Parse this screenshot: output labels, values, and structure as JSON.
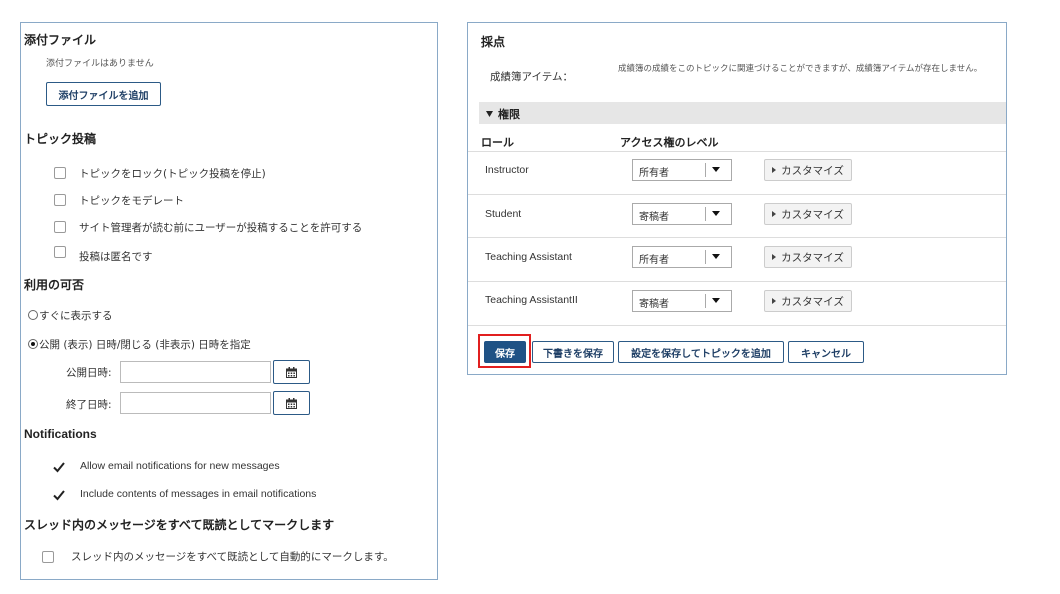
{
  "attachments": {
    "title": "添付ファイル",
    "empty": "添付ファイルはありません",
    "add_button": "添付ファイルを追加"
  },
  "topic_posting": {
    "title": "トピック投稿",
    "options": [
      {
        "label": "トピックをロック(トピック投稿を停止)",
        "checked": false
      },
      {
        "label": "トピックをモデレート",
        "checked": false
      },
      {
        "label": "サイト管理者が読む前にユーザーが投稿することを許可する",
        "checked": false
      },
      {
        "label": "投稿は匿名です",
        "checked": false
      }
    ]
  },
  "availability": {
    "title": "利用の可否",
    "option_immediate": "すぐに表示する",
    "option_schedule": "公開 (表示) 日時/閉じる (非表示) 日時を指定",
    "selected": "schedule",
    "open_label": "公開日時:",
    "close_label": "終了日時:",
    "open_value": "",
    "close_value": ""
  },
  "notifications": {
    "title": "Notifications",
    "options": [
      {
        "label": "Allow email notifications for new messages",
        "checked": true
      },
      {
        "label": "Include contents of messages in email notifications",
        "checked": true
      }
    ]
  },
  "mark_read": {
    "title": "スレッド内のメッセージをすべて既読としてマークします",
    "option": "スレッド内のメッセージをすべて既読として自動的にマークします。",
    "checked": false
  },
  "grading": {
    "title": "採点",
    "gradebook_label": "成績簿アイテム：",
    "gradebook_note": "成績簿の成績をこのトピックに関連づけることができますが、成績簿アイテムが存在しません。"
  },
  "permissions": {
    "title": "権限",
    "col_role": "ロール",
    "col_level": "アクセス権のレベル",
    "rows": [
      {
        "role": "Instructor",
        "level": "所有者",
        "customize": "カスタマイズ"
      },
      {
        "role": "Student",
        "level": "寄稿者",
        "customize": "カスタマイズ"
      },
      {
        "role": "Teaching Assistant",
        "level": "所有者",
        "customize": "カスタマイズ"
      },
      {
        "role": "Teaching AssistantII",
        "level": "寄稿者",
        "customize": "カスタマイズ"
      }
    ]
  },
  "actions": {
    "save": "保存",
    "save_draft": "下書きを保存",
    "save_and_add": "設定を保存してトピックを追加",
    "cancel": "キャンセル"
  },
  "colors": {
    "primary": "#1f5285",
    "border": "#8aa9c7",
    "highlight": "#e11f1f"
  }
}
